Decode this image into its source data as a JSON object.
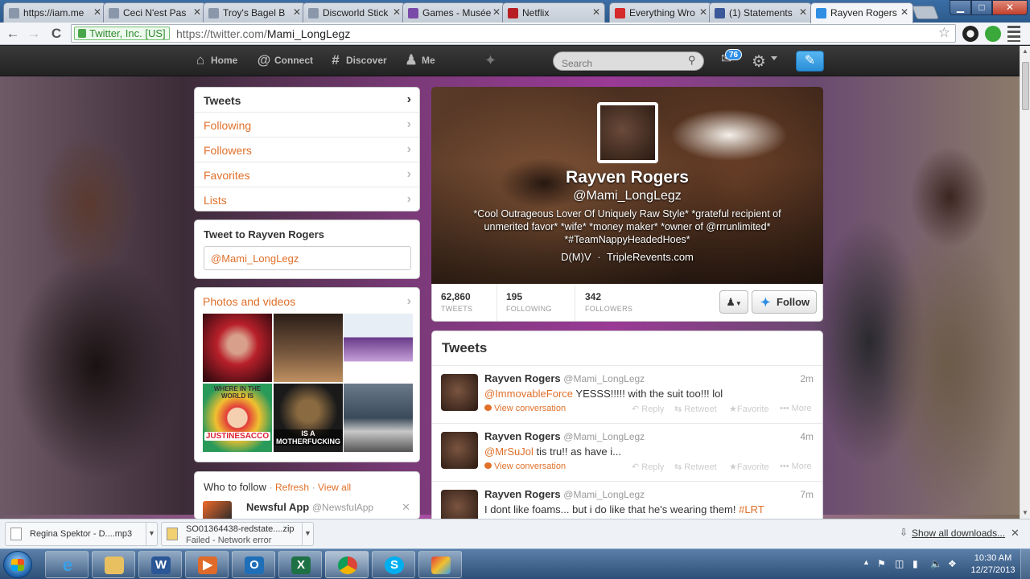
{
  "browser": {
    "tabs": [
      {
        "title": "https://iam.me"
      },
      {
        "title": "Ceci N'est Pas"
      },
      {
        "title": "Troy's Bagel B"
      },
      {
        "title": "Discworld Stick"
      },
      {
        "title": "Games - Musée"
      },
      {
        "title": "Netflix"
      },
      {
        "title": "Everything Wro"
      },
      {
        "title": "(1) Statements"
      },
      {
        "title": "Rayven Rogers"
      }
    ],
    "back_glyph": "←",
    "forward_glyph": "→",
    "reload_glyph": "C",
    "ev_badge": "Twitter, Inc. [US]",
    "url_scheme_host": "https://twitter.com/",
    "url_path": "Mami_LongLegz",
    "star_glyph": "☆",
    "win_min": "▁",
    "win_max": "□",
    "win_close": "✕"
  },
  "twitter_nav": {
    "home": "Home",
    "connect": "Connect",
    "discover": "Discover",
    "me": "Me",
    "search_placeholder": "Search",
    "dm_count": "76"
  },
  "profile_nav": {
    "items": [
      {
        "label": "Tweets"
      },
      {
        "label": "Following"
      },
      {
        "label": "Followers"
      },
      {
        "label": "Favorites"
      },
      {
        "label": "Lists"
      }
    ]
  },
  "tweet_to": {
    "title": "Tweet to Rayven Rogers",
    "value": "@Mami_LongLegz"
  },
  "photos": {
    "title": "Photos and videos",
    "captions": [
      "JUSTINESACCO",
      "IS A MOTHERFUCKING",
      "WHERE IN THE WORLD IS"
    ]
  },
  "who_to_follow": {
    "title": "Who to follow",
    "refresh": "Refresh",
    "view_all": "View all",
    "suggestion_name": "Newsful App",
    "suggestion_handle": "@NewsfulApp"
  },
  "profile": {
    "name": "Rayven Rogers",
    "handle": "@Mami_LongLegz",
    "bio": "*Cool Outrageous Lover Of Uniquely Raw Style* *grateful recipient of unmerited favor* *wife* *money maker* *owner of @rrrunlimited* *#TeamNappyHeadedHoes*",
    "location": "D(M)V",
    "separator": "·",
    "website": "TripleRevents.com",
    "stats": [
      {
        "value": "62,860",
        "label": "TWEETS"
      },
      {
        "value": "195",
        "label": "FOLLOWING"
      },
      {
        "value": "342",
        "label": "FOLLOWERS"
      }
    ],
    "follow_label": "Follow"
  },
  "stream": {
    "title": "Tweets",
    "actions": {
      "reply": "Reply",
      "retweet": "Retweet",
      "favorite": "Favorite",
      "more": "More"
    },
    "tweets": [
      {
        "name": "Rayven Rogers",
        "handle": "@Mami_LongLegz",
        "time": "2m",
        "mention": "@ImmovableForce",
        "text": " YESSS!!!!! with the suit too!!! lol",
        "conversation": "View conversation"
      },
      {
        "name": "Rayven Rogers",
        "handle": "@Mami_LongLegz",
        "time": "4m",
        "mention": "@MrSuJol",
        "text": " tis tru!! as have i...",
        "conversation": "View conversation"
      },
      {
        "name": "Rayven Rogers",
        "handle": "@Mami_LongLegz",
        "time": "7m",
        "text": "I dont like foams... but i do like that he's wearing them! ",
        "hashtag": "#LRT"
      }
    ]
  },
  "downloads": {
    "items": [
      {
        "name": "Regina Spektor - D....mp3",
        "status": ""
      },
      {
        "name": "SO01364438-redstate....zip",
        "status": "Failed - Network error"
      }
    ],
    "show_all": "Show all downloads...",
    "close_glyph": "✕"
  },
  "taskbar": {
    "time": "10:30 AM",
    "date": "12/27/2013"
  },
  "colors": {
    "twitter_orange": "#e0702a",
    "twitter_blue": "#2f8ee3",
    "topbar": "#2b2b2b"
  }
}
